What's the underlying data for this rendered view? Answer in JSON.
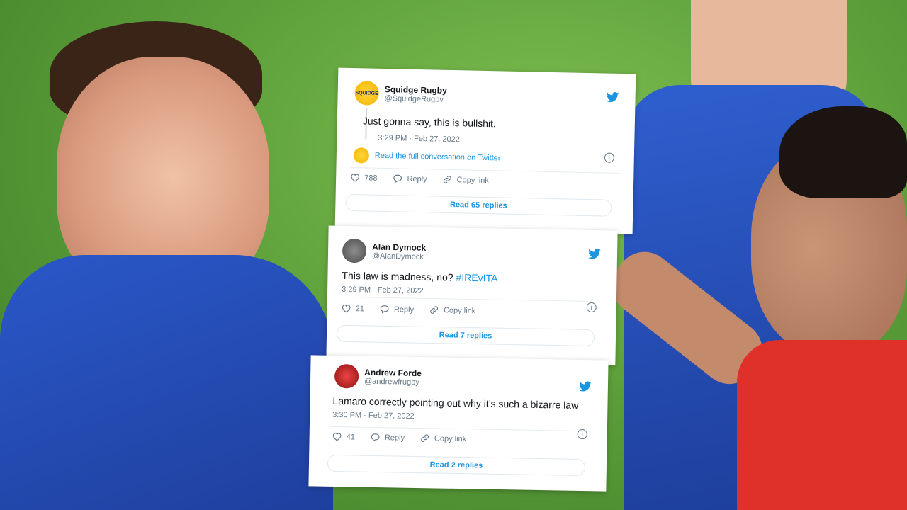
{
  "tweets": [
    {
      "name": "Squidge Rugby",
      "handle": "@SquidgeRugby",
      "avatar_text": "SQUIDGE",
      "text": "Just gonna say, this is bullshit.",
      "time": "3:29 PM · Feb 27, 2022",
      "conversation_link": "Read the full conversation on Twitter",
      "likes": "788",
      "reply_label": "Reply",
      "copy_label": "Copy link",
      "read_replies": "Read 65 replies"
    },
    {
      "name": "Alan Dymock",
      "handle": "@AlanDymock",
      "text": "This law is madness, no?",
      "hashtag": "#IREvITA",
      "time": "3:29 PM · Feb 27, 2022",
      "likes": "21",
      "reply_label": "Reply",
      "copy_label": "Copy link",
      "read_replies": "Read 7 replies"
    },
    {
      "name": "Andrew Forde",
      "handle": "@andrewfrugby",
      "text": "Lamaro correctly pointing out why it’s such a bizarre law",
      "time": "3:30 PM · Feb 27, 2022",
      "likes": "41",
      "reply_label": "Reply",
      "copy_label": "Copy link",
      "read_replies": "Read 2 replies"
    }
  ],
  "icons": [
    "twitter-bird-icon",
    "heart-icon",
    "reply-icon",
    "link-icon",
    "info-icon"
  ],
  "colors": {
    "twitter_blue": "#1b95e0",
    "jersey_blue": "#2a58c8",
    "referee_red": "#e0302a",
    "pitch_green": "#5ea03a"
  }
}
